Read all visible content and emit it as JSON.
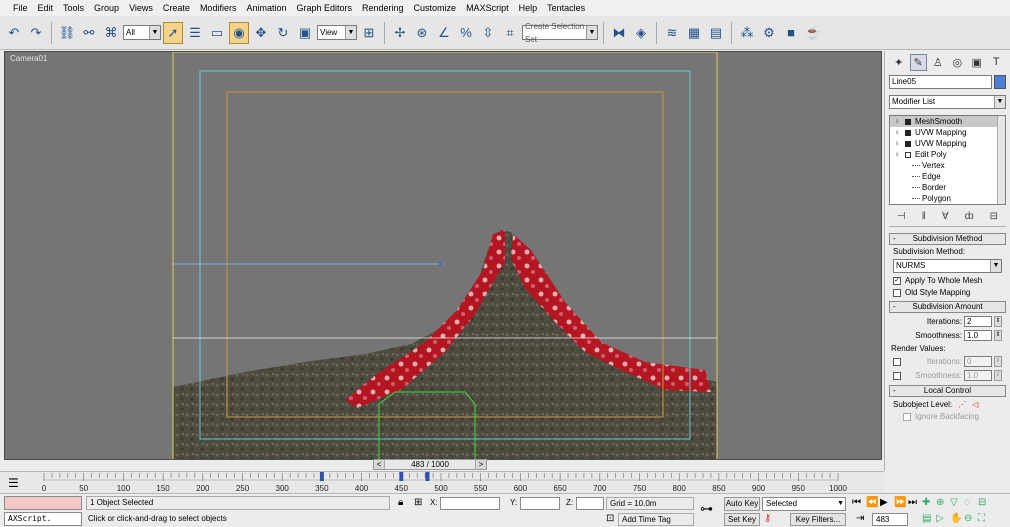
{
  "menu": [
    "File",
    "Edit",
    "Tools",
    "Group",
    "Views",
    "Create",
    "Modifiers",
    "Animation",
    "Graph Editors",
    "Rendering",
    "Customize",
    "MAXScript",
    "Help",
    "Tentacles"
  ],
  "toolbar": {
    "filter_value": "All",
    "refcoord_value": "View",
    "named_selection_placeholder": "Create Selection Set",
    "icons": [
      "undo-icon",
      "redo-icon",
      "link-icon",
      "unlink-icon",
      "bind-spacewarp-icon",
      "select-icon",
      "select-by-name-icon",
      "rect-selection-icon",
      "window-crossing-icon",
      "move-icon",
      "rotate-icon",
      "scale-icon",
      "pivot-icon",
      "manipulate-icon",
      "snap-icon",
      "angle-snap-icon",
      "percent-snap-icon",
      "spinner-snap-icon",
      "edit-named-sets-icon",
      "mirror-icon",
      "align-icon",
      "layer-manager-icon",
      "curve-editor-icon",
      "schematic-icon",
      "material-editor-icon",
      "render-setup-icon",
      "render-frame-icon",
      "quick-render-icon"
    ]
  },
  "viewport": {
    "label": "Camera01"
  },
  "command_panel": {
    "object_name": "Line05",
    "object_color": "#4e7fd6",
    "modifier_list_label": "Modifier List",
    "stack": [
      {
        "label": "MeshSmooth",
        "type": "modifier",
        "selected": true
      },
      {
        "label": "UVW Mapping",
        "type": "modifier",
        "selected": false
      },
      {
        "label": "UVW Mapping",
        "type": "modifier",
        "selected": false
      },
      {
        "label": "Edit Poly",
        "type": "base",
        "selected": false
      },
      {
        "label": "Vertex",
        "type": "sub",
        "selected": false
      },
      {
        "label": "Edge",
        "type": "sub",
        "selected": false
      },
      {
        "label": "Border",
        "type": "sub",
        "selected": false
      },
      {
        "label": "Polygon",
        "type": "sub",
        "selected": false
      }
    ],
    "subdivision_method": {
      "rollout_title": "Subdivision Method",
      "label": "Subdivision Method:",
      "method_value": "NURMS",
      "apply_whole_mesh_label": "Apply To Whole Mesh",
      "apply_whole_mesh_checked": true,
      "old_style_label": "Old Style Mapping",
      "old_style_checked": false
    },
    "subdivision_amount": {
      "rollout_title": "Subdivision Amount",
      "iterations_label": "Iterations:",
      "iterations_value": "2",
      "smoothness_label": "Smoothness:",
      "smoothness_value": "1.0",
      "render_values_label": "Render Values:",
      "render_iterations_label": "Iterations:",
      "render_iterations_value": "0",
      "render_smoothness_label": "Smoothness:",
      "render_smoothness_value": "1.0"
    },
    "local_control": {
      "rollout_title": "Local Control",
      "subobject_level_label": "Subobject Level:",
      "ignore_backfacing_label": "Ignore Backfacing"
    }
  },
  "timeline": {
    "current_frame_label": "483 / 1000",
    "ticks": [
      "0",
      "50",
      "100",
      "150",
      "200",
      "250",
      "300",
      "350",
      "400",
      "450",
      "500",
      "550",
      "600",
      "650",
      "700",
      "750",
      "800",
      "850",
      "900",
      "950",
      "1000"
    ],
    "tick_values": [
      0,
      50,
      100,
      150,
      200,
      250,
      300,
      350,
      400,
      450,
      500,
      550,
      600,
      650,
      700,
      750,
      800,
      850,
      900,
      950,
      1000
    ],
    "key_frames": [
      350,
      450,
      483
    ],
    "max_frame": 1000
  },
  "status": {
    "maxscript_label": "AXScript.",
    "selection_text": "1 Object Selected",
    "prompt_text": "Click or click-and-drag to select objects",
    "x_label": "X:",
    "y_label": "Y:",
    "z_label": "Z:",
    "grid_text": "Grid = 10.0m",
    "add_time_tag": "Add Time Tag",
    "auto_key_label": "Auto Key",
    "selected_value": "Selected",
    "set_key_label": "Set Key",
    "key_filters_label": "Key Filters...",
    "frame_field": "483"
  }
}
